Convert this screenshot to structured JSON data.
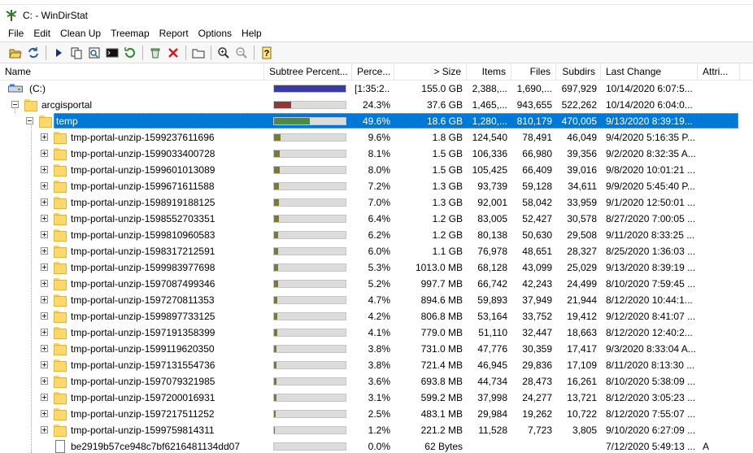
{
  "window": {
    "title": "C: - WinDirStat"
  },
  "menu": [
    "File",
    "Edit",
    "Clean Up",
    "Treemap",
    "Report",
    "Options",
    "Help"
  ],
  "toolbar": {
    "buttons": [
      "open-folder-icon",
      "refresh-icon",
      "run-icon",
      "copy-icon",
      "explorer-icon",
      "command-prompt-icon",
      "refresh-all-icon",
      "recycle-bin-icon",
      "delete-icon",
      "properties-icon",
      "zoom-in-icon",
      "zoom-out-icon",
      "help-icon"
    ]
  },
  "columns": {
    "name": "Name",
    "subtree": "Subtree Percent...",
    "percent": "Perce...",
    "size": "> Size",
    "items": "Items",
    "files": "Files",
    "subdirs": "Subdirs",
    "last_change": "Last Change",
    "attributes": "Attri..."
  },
  "colors": {
    "selection": "#0078d7",
    "bar_root": "#3a3aa4",
    "bar_level1": "#8b3a3a",
    "bar_level2": "#4a8a4a",
    "bar_level3": "#7a7a34"
  },
  "rows": [
    {
      "level": 0,
      "icon": "drive-icon",
      "expander": "none",
      "name": "(C:)",
      "bar": 1.0,
      "bar_color": "#3a3aa4",
      "percent": "[1:35:2...",
      "size": "155.0 GB",
      "items": "2,388,...",
      "files": "1,690,...",
      "subdirs": "697,929",
      "last_change": "10/14/2020 6:07:5...",
      "attr": ""
    },
    {
      "level": 1,
      "icon": "folder-icon",
      "expander": "minus",
      "name": "arcgisportal",
      "bar": 0.243,
      "bar_color": "#8b3a3a",
      "percent": "24.3%",
      "size": "37.6 GB",
      "items": "1,465,...",
      "files": "943,655",
      "subdirs": "522,262",
      "last_change": "10/14/2020 6:04:0...",
      "attr": ""
    },
    {
      "level": 2,
      "icon": "folder-icon",
      "expander": "minus",
      "name": "temp",
      "bar": 0.496,
      "bar_color": "#4a8a4a",
      "percent": "49.6%",
      "size": "18.6 GB",
      "items": "1,280,...",
      "files": "810,179",
      "subdirs": "470,005",
      "last_change": "9/13/2020 8:39:19...",
      "attr": "",
      "selected": true
    },
    {
      "level": 3,
      "icon": "folder-icon",
      "expander": "plus",
      "name": "tmp-portal-unzip-1599237611696",
      "bar": 0.096,
      "bar_color": "#7a7a34",
      "percent": "9.6%",
      "size": "1.8 GB",
      "items": "124,540",
      "files": "78,491",
      "subdirs": "46,049",
      "last_change": "9/4/2020 5:16:35 P...",
      "attr": ""
    },
    {
      "level": 3,
      "icon": "folder-icon",
      "expander": "plus",
      "name": "tmp-portal-unzip-1599033400728",
      "bar": 0.081,
      "bar_color": "#7a7a34",
      "percent": "8.1%",
      "size": "1.5 GB",
      "items": "106,336",
      "files": "66,980",
      "subdirs": "39,356",
      "last_change": "9/2/2020 8:32:35 A...",
      "attr": ""
    },
    {
      "level": 3,
      "icon": "folder-icon",
      "expander": "plus",
      "name": "tmp-portal-unzip-1599601013089",
      "bar": 0.08,
      "bar_color": "#7a7a34",
      "percent": "8.0%",
      "size": "1.5 GB",
      "items": "105,425",
      "files": "66,409",
      "subdirs": "39,016",
      "last_change": "9/8/2020 10:01:21 ...",
      "attr": ""
    },
    {
      "level": 3,
      "icon": "folder-icon",
      "expander": "plus",
      "name": "tmp-portal-unzip-1599671611588",
      "bar": 0.072,
      "bar_color": "#7a7a34",
      "percent": "7.2%",
      "size": "1.3 GB",
      "items": "93,739",
      "files": "59,128",
      "subdirs": "34,611",
      "last_change": "9/9/2020 5:45:40 P...",
      "attr": ""
    },
    {
      "level": 3,
      "icon": "folder-icon",
      "expander": "plus",
      "name": "tmp-portal-unzip-1598919188125",
      "bar": 0.07,
      "bar_color": "#7a7a34",
      "percent": "7.0%",
      "size": "1.3 GB",
      "items": "92,001",
      "files": "58,042",
      "subdirs": "33,959",
      "last_change": "9/1/2020 12:50:01 ...",
      "attr": ""
    },
    {
      "level": 3,
      "icon": "folder-icon",
      "expander": "plus",
      "name": "tmp-portal-unzip-1598552703351",
      "bar": 0.064,
      "bar_color": "#7a7a34",
      "percent": "6.4%",
      "size": "1.2 GB",
      "items": "83,005",
      "files": "52,427",
      "subdirs": "30,578",
      "last_change": "8/27/2020 7:00:05 ...",
      "attr": ""
    },
    {
      "level": 3,
      "icon": "folder-icon",
      "expander": "plus",
      "name": "tmp-portal-unzip-1599810960583",
      "bar": 0.062,
      "bar_color": "#7a7a34",
      "percent": "6.2%",
      "size": "1.2 GB",
      "items": "80,138",
      "files": "50,630",
      "subdirs": "29,508",
      "last_change": "9/11/2020 8:33:25 ...",
      "attr": ""
    },
    {
      "level": 3,
      "icon": "folder-icon",
      "expander": "plus",
      "name": "tmp-portal-unzip-1598317212591",
      "bar": 0.06,
      "bar_color": "#7a7a34",
      "percent": "6.0%",
      "size": "1.1 GB",
      "items": "76,978",
      "files": "48,651",
      "subdirs": "28,327",
      "last_change": "8/25/2020 1:36:03 ...",
      "attr": ""
    },
    {
      "level": 3,
      "icon": "folder-icon",
      "expander": "plus",
      "name": "tmp-portal-unzip-1599983977698",
      "bar": 0.053,
      "bar_color": "#7a7a34",
      "percent": "5.3%",
      "size": "1013.0 MB",
      "items": "68,128",
      "files": "43,099",
      "subdirs": "25,029",
      "last_change": "9/13/2020 8:39:19 ...",
      "attr": ""
    },
    {
      "level": 3,
      "icon": "folder-icon",
      "expander": "plus",
      "name": "tmp-portal-unzip-1597087499346",
      "bar": 0.052,
      "bar_color": "#7a7a34",
      "percent": "5.2%",
      "size": "997.7 MB",
      "items": "66,742",
      "files": "42,243",
      "subdirs": "24,499",
      "last_change": "8/10/2020 7:59:45 ...",
      "attr": ""
    },
    {
      "level": 3,
      "icon": "folder-icon",
      "expander": "plus",
      "name": "tmp-portal-unzip-1597270811353",
      "bar": 0.047,
      "bar_color": "#7a7a34",
      "percent": "4.7%",
      "size": "894.6 MB",
      "items": "59,893",
      "files": "37,949",
      "subdirs": "21,944",
      "last_change": "8/12/2020 10:44:1...",
      "attr": ""
    },
    {
      "level": 3,
      "icon": "folder-icon",
      "expander": "plus",
      "name": "tmp-portal-unzip-1599897733125",
      "bar": 0.042,
      "bar_color": "#7a7a34",
      "percent": "4.2%",
      "size": "806.8 MB",
      "items": "53,164",
      "files": "33,752",
      "subdirs": "19,412",
      "last_change": "9/12/2020 8:41:07 ...",
      "attr": ""
    },
    {
      "level": 3,
      "icon": "folder-icon",
      "expander": "plus",
      "name": "tmp-portal-unzip-1597191358399",
      "bar": 0.041,
      "bar_color": "#7a7a34",
      "percent": "4.1%",
      "size": "779.0 MB",
      "items": "51,110",
      "files": "32,447",
      "subdirs": "18,663",
      "last_change": "8/12/2020 12:40:2...",
      "attr": ""
    },
    {
      "level": 3,
      "icon": "folder-icon",
      "expander": "plus",
      "name": "tmp-portal-unzip-1599119620350",
      "bar": 0.038,
      "bar_color": "#7a7a34",
      "percent": "3.8%",
      "size": "731.0 MB",
      "items": "47,776",
      "files": "30,359",
      "subdirs": "17,417",
      "last_change": "9/3/2020 8:33:04 A...",
      "attr": ""
    },
    {
      "level": 3,
      "icon": "folder-icon",
      "expander": "plus",
      "name": "tmp-portal-unzip-1597131554736",
      "bar": 0.038,
      "bar_color": "#7a7a34",
      "percent": "3.8%",
      "size": "721.4 MB",
      "items": "46,945",
      "files": "29,836",
      "subdirs": "17,109",
      "last_change": "8/11/2020 8:13:30 ...",
      "attr": ""
    },
    {
      "level": 3,
      "icon": "folder-icon",
      "expander": "plus",
      "name": "tmp-portal-unzip-1597079321985",
      "bar": 0.036,
      "bar_color": "#7a7a34",
      "percent": "3.6%",
      "size": "693.8 MB",
      "items": "44,734",
      "files": "28,473",
      "subdirs": "16,261",
      "last_change": "8/10/2020 5:38:09 ...",
      "attr": ""
    },
    {
      "level": 3,
      "icon": "folder-icon",
      "expander": "plus",
      "name": "tmp-portal-unzip-1597200016931",
      "bar": 0.031,
      "bar_color": "#7a7a34",
      "percent": "3.1%",
      "size": "599.2 MB",
      "items": "37,998",
      "files": "24,277",
      "subdirs": "13,721",
      "last_change": "8/12/2020 3:05:23 ...",
      "attr": ""
    },
    {
      "level": 3,
      "icon": "folder-icon",
      "expander": "plus",
      "name": "tmp-portal-unzip-1597217511252",
      "bar": 0.025,
      "bar_color": "#7a7a34",
      "percent": "2.5%",
      "size": "483.1 MB",
      "items": "29,984",
      "files": "19,262",
      "subdirs": "10,722",
      "last_change": "8/12/2020 7:55:07 ...",
      "attr": ""
    },
    {
      "level": 3,
      "icon": "folder-icon",
      "expander": "plus",
      "name": "tmp-portal-unzip-1599759814311",
      "bar": 0.012,
      "bar_color": "#7a7a34",
      "percent": "1.2%",
      "size": "221.2 MB",
      "items": "11,528",
      "files": "7,723",
      "subdirs": "3,805",
      "last_change": "9/10/2020 6:27:09 ...",
      "attr": ""
    },
    {
      "level": 3,
      "icon": "file-icon",
      "expander": "none",
      "name": "be2919b57ce948c7bf6216481134dd07",
      "bar": 0.0,
      "bar_color": "#7a7a34",
      "percent": "0.0%",
      "size": "62 Bytes",
      "items": "",
      "files": "",
      "subdirs": "",
      "last_change": "7/12/2020 5:49:13 ...",
      "attr": "A"
    }
  ]
}
